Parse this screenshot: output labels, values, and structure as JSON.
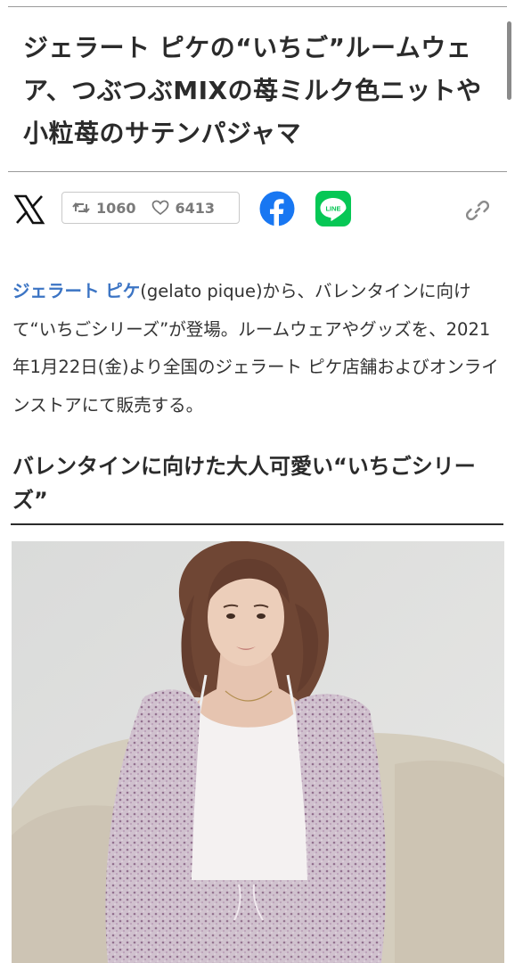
{
  "article": {
    "title": "ジェラート ピケの“いちご”ルームウェア、つぶつぶMIXの苺ミルク色ニットや小粒苺のサテンパジャマ",
    "share": {
      "x_icon": "x-logo-icon",
      "retweet_icon": "retweet-icon",
      "retweet_count": "1060",
      "like_icon": "heart-icon",
      "like_count": "6413",
      "facebook_icon": "facebook-icon",
      "line_icon": "line-icon",
      "line_label": "LINE",
      "link_icon": "link-icon"
    },
    "lead": {
      "brand_link": "ジェラート ピケ",
      "rest": "(gelato pique)から、バレンタインに向けて“いちごシリーズ”が登場。ルームウェアやグッズを、2021年1月22日(金)より全国のジェラート ピケ店舗およびオンラインストアにて販売する。"
    },
    "section_heading": "バレンタインに向けた大人可愛い“いちごシリーズ”"
  },
  "colors": {
    "link": "#3b74c4",
    "facebook": "#1877f2",
    "line": "#06c755",
    "text": "#2b2b2b"
  }
}
